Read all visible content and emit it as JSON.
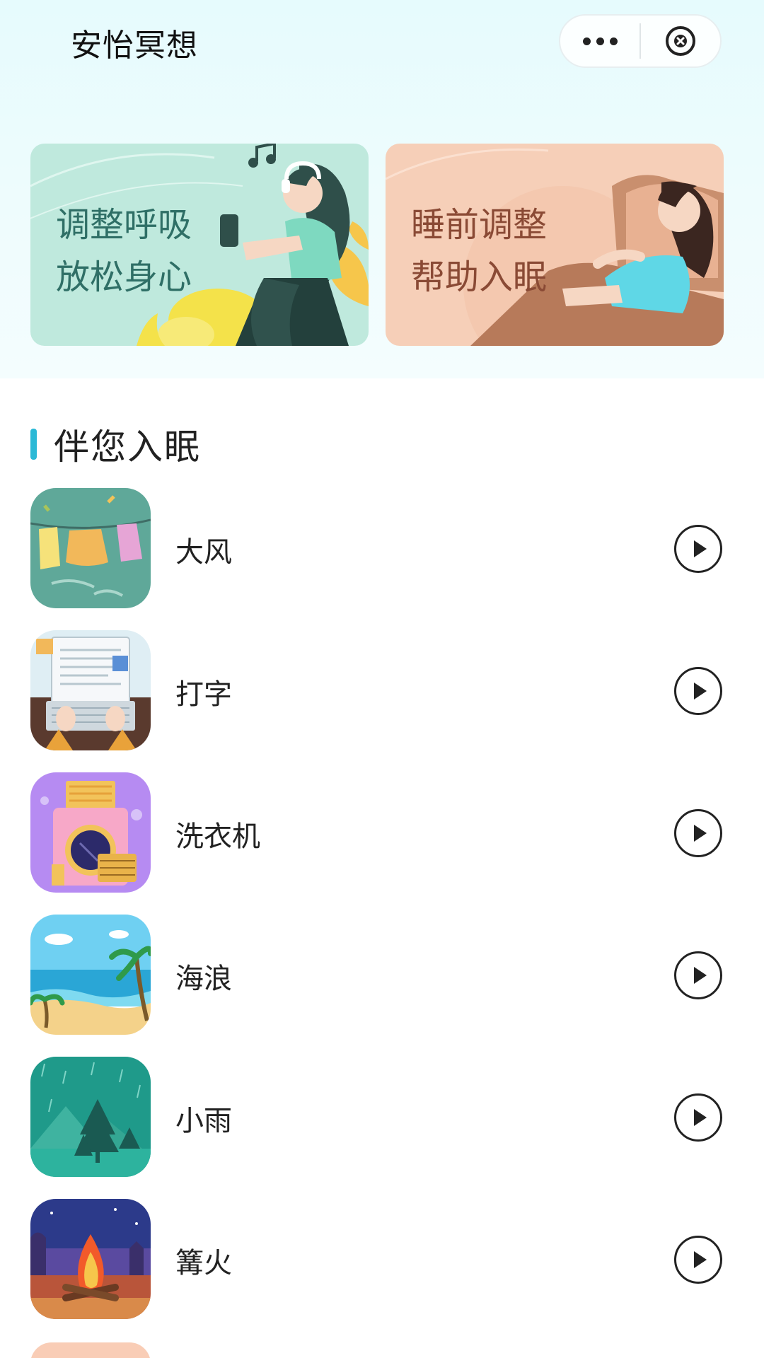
{
  "app": {
    "title": "安怡冥想"
  },
  "capsule": {
    "more_icon": "more-dots-icon",
    "close_icon": "close-circle-icon"
  },
  "banners": [
    {
      "line1": "调整呼吸",
      "line2": "放松身心",
      "bg": "#bfe9dd"
    },
    {
      "line1": "睡前调整",
      "line2": "帮助入眠",
      "bg": "#f6cfb8"
    }
  ],
  "section": {
    "title": "伴您入眠",
    "accent": "#2bb9d6"
  },
  "sounds": [
    {
      "label": "大风",
      "icon": "wind-clothesline-icon"
    },
    {
      "label": "打字",
      "icon": "laptop-typing-icon"
    },
    {
      "label": "洗衣机",
      "icon": "washing-machine-icon"
    },
    {
      "label": "海浪",
      "icon": "beach-waves-icon"
    },
    {
      "label": "小雨",
      "icon": "rain-forest-icon"
    },
    {
      "label": "篝火",
      "icon": "campfire-icon"
    }
  ]
}
